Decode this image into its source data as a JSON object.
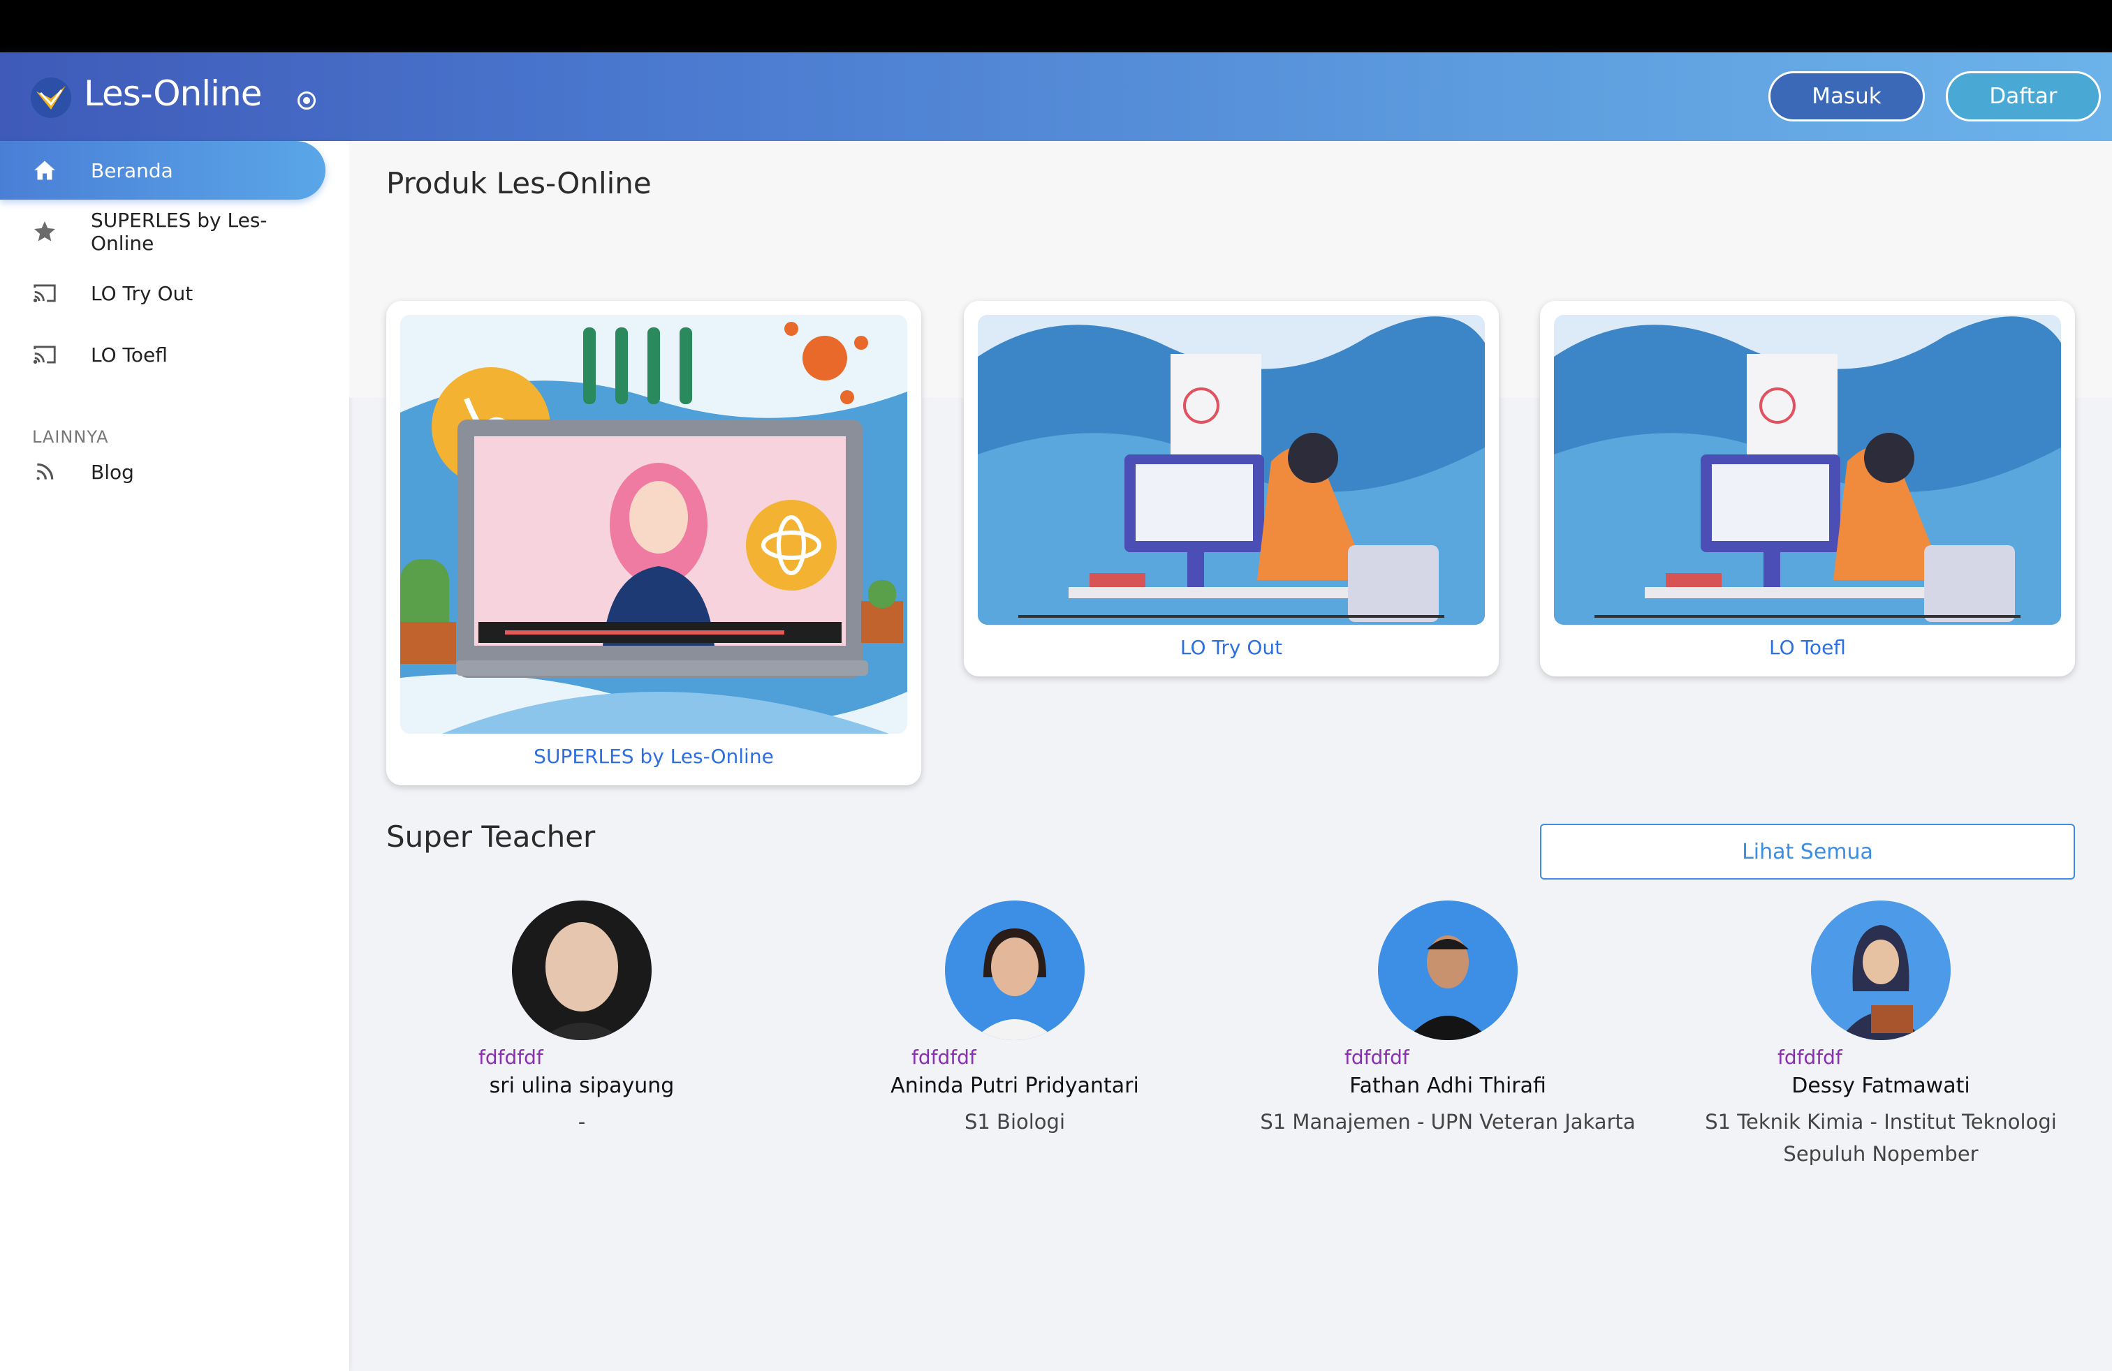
{
  "header": {
    "brand": "Les-Online",
    "login_label": "Masuk",
    "register_label": "Daftar"
  },
  "sidebar": {
    "items": [
      {
        "label": "Beranda",
        "icon": "home-icon",
        "active": true
      },
      {
        "label": "SUPERLES by Les-Online",
        "icon": "star-icon"
      },
      {
        "label": "LO Try Out",
        "icon": "cast-icon"
      },
      {
        "label": "LO Toefl",
        "icon": "cast-icon"
      }
    ],
    "section_label": "LAINNYA",
    "other_items": [
      {
        "label": "Blog",
        "icon": "rss-icon"
      }
    ]
  },
  "products": {
    "title": "Produk Les-Online",
    "cards": [
      {
        "caption": "SUPERLES by Les-Online"
      },
      {
        "caption": "LO Try Out"
      },
      {
        "caption": "LO Toefl"
      }
    ]
  },
  "teachers": {
    "title": "Super Teacher",
    "see_all_label": "Lihat Semua",
    "list": [
      {
        "tag": "fdfdfdf",
        "name": "sri ulina sipayung",
        "education": "-"
      },
      {
        "tag": "fdfdfdf",
        "name": "Aninda Putri Pridyantari",
        "education": "S1 Biologi"
      },
      {
        "tag": "fdfdfdf",
        "name": "Fathan Adhi Thirafi",
        "education": "S1 Manajemen - UPN Veteran Jakarta"
      },
      {
        "tag": "fdfdfdf",
        "name": "Dessy Fatmawati",
        "education": "S1 Teknik Kimia - Institut Teknologi Sepuluh Nopember"
      }
    ]
  },
  "colors": {
    "accent": "#2e6fe0",
    "header_start": "#3f5ab8",
    "header_end": "#6cb3ea",
    "tag": "#8a2fb0"
  }
}
